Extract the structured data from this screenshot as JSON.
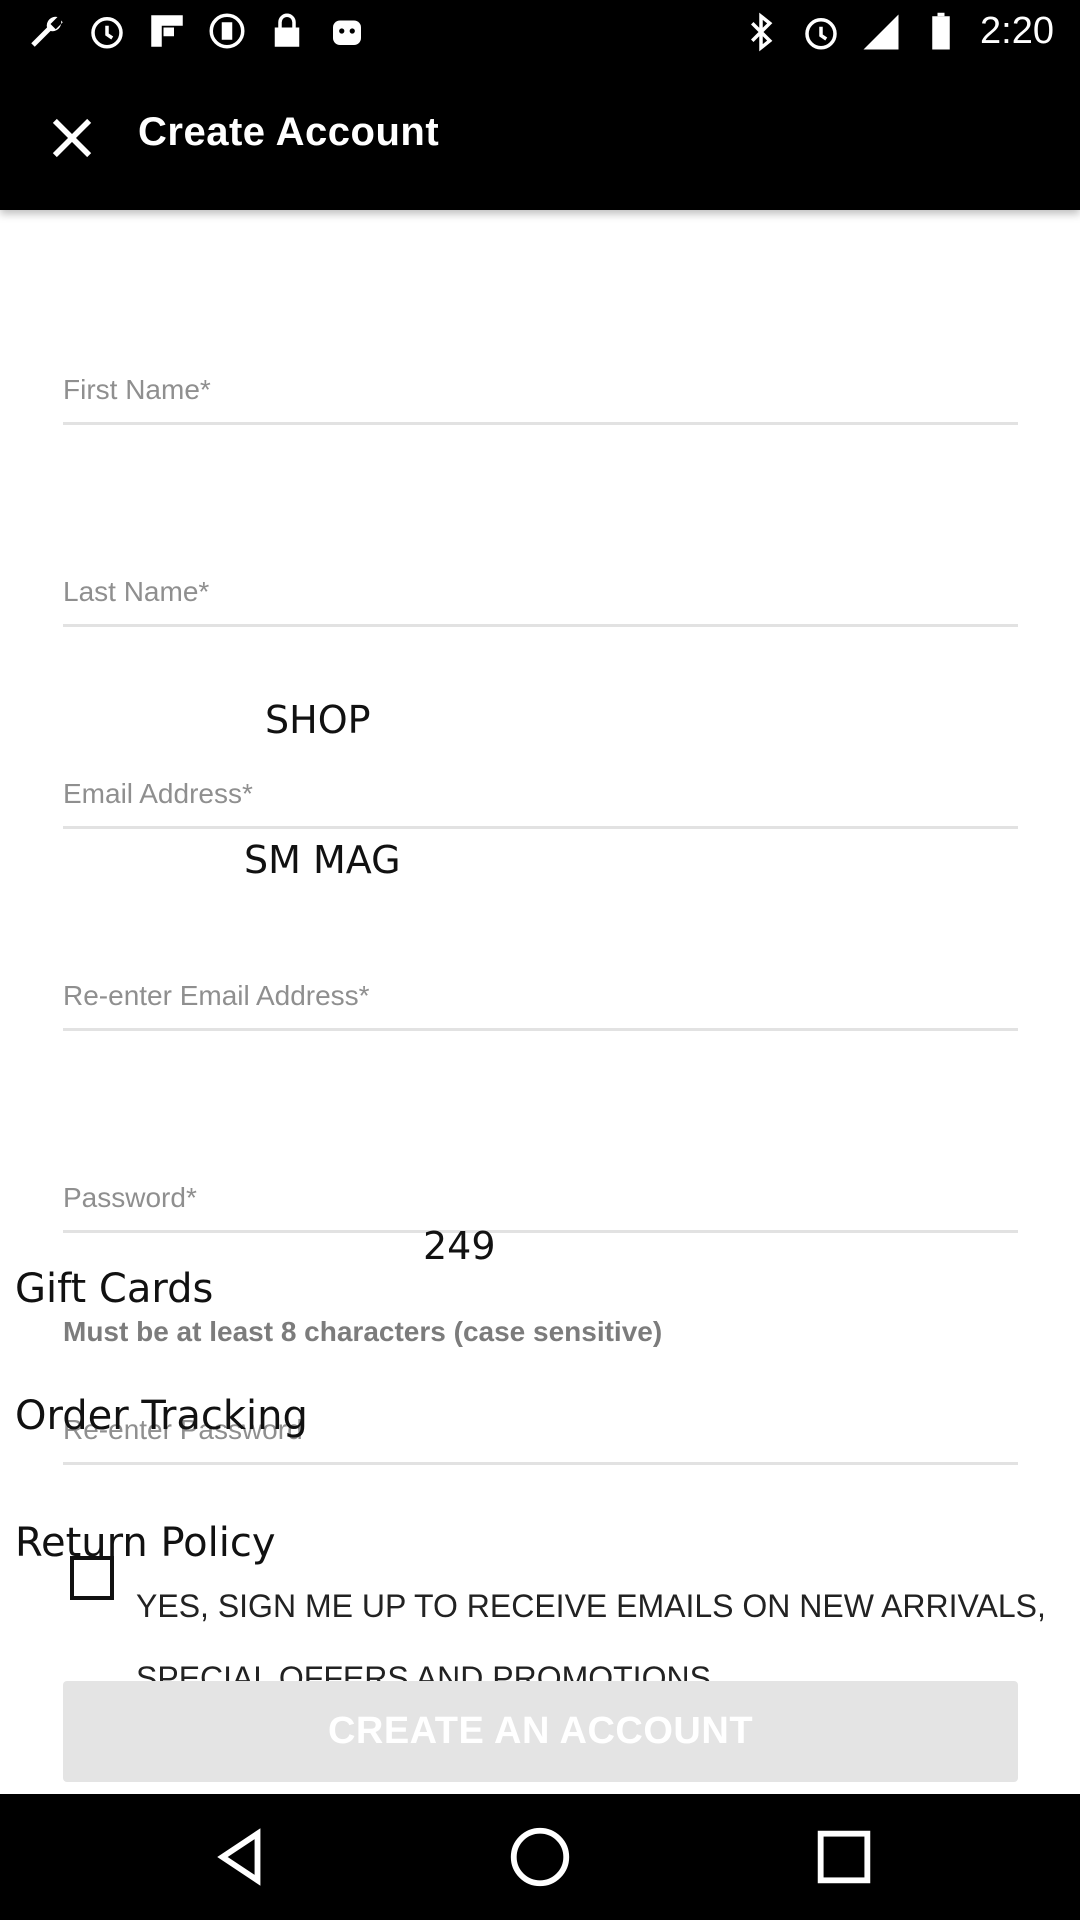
{
  "status_bar": {
    "time": "2:20",
    "left_icons": [
      "wrench-icon",
      "alarm-icon",
      "flipboard-icon",
      "record-icon",
      "lock-icon",
      "android-icon"
    ],
    "right_icons": [
      "bluetooth-icon",
      "alarm-icon",
      "signal-icon",
      "battery-icon"
    ]
  },
  "app_bar": {
    "title": "Create Account",
    "close_icon": "close-icon"
  },
  "form": {
    "first_name_placeholder": "First Name*",
    "last_name_placeholder": "Last Name*",
    "email_placeholder": "Email Address*",
    "reenter_email_placeholder": "Re-enter Email Address*",
    "password_placeholder": "Password*",
    "password_hint": "Must be at least 8 characters (case sensitive)",
    "reenter_password_placeholder": "Re-enter Password"
  },
  "overlay_text": {
    "shop": "SHOP",
    "sm_mag": "SM MAG",
    "count": "249",
    "gift_cards": "Gift Cards",
    "order_tracking": "Order Tracking",
    "return_policy": "Return Policy"
  },
  "signup": {
    "line1": "YES, SIGN ME UP TO RECEIVE EMAILS ON NEW ARRIVALS,",
    "line2": "SPECIAL OFFERS AND PROMOTIONS."
  },
  "create_button_label": "CREATE AN ACCOUNT",
  "colors": {
    "bar": "#000000",
    "button_disabled": "#e4e4e4",
    "placeholder": "#8f8f8f"
  }
}
